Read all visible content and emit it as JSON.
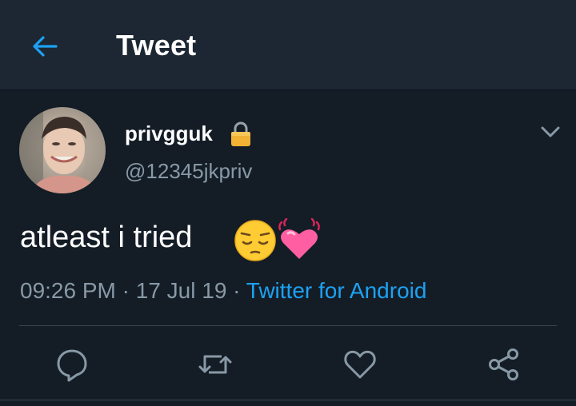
{
  "header": {
    "title": "Tweet",
    "back_icon": "arrow-left-icon"
  },
  "tweet": {
    "display_name": "privgguk",
    "protected_icon": "lock-icon",
    "handle": "@12345jkpriv",
    "text": "atleast i tried",
    "emojis": [
      "pensive-face-emoji",
      "beating-heart-emoji"
    ],
    "time": "09:26 PM",
    "date": "17 Jul 19",
    "separator": "·",
    "source": "Twitter for Android",
    "menu_icon": "chevron-down-icon"
  },
  "actions": [
    {
      "icon": "reply-icon"
    },
    {
      "icon": "retweet-icon"
    },
    {
      "icon": "like-icon"
    },
    {
      "icon": "share-icon"
    }
  ],
  "colors": {
    "background": "#141d26",
    "header_background": "#1c2733",
    "accent": "#1da1f2",
    "secondary_text": "#8899a6",
    "divider": "#38444d"
  }
}
